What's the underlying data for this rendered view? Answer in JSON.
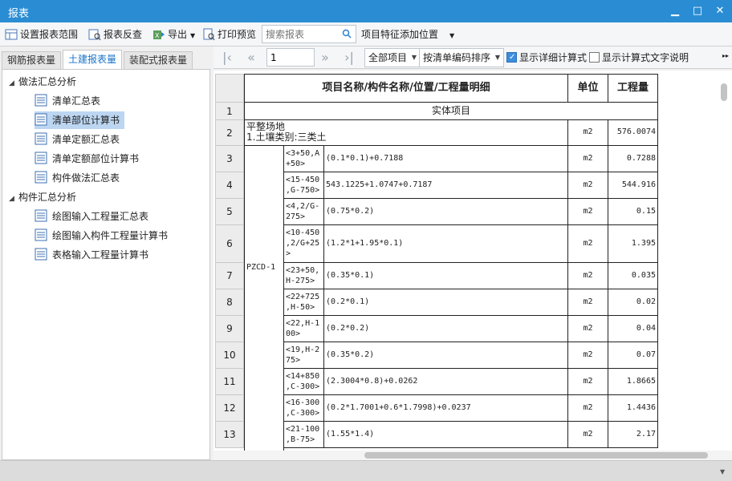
{
  "window": {
    "title": "报表",
    "min": "▁",
    "max": "□",
    "close": "✕"
  },
  "toolbar": {
    "set_range": "设置报表范围",
    "reverse": "报表反查",
    "export": "导出",
    "print_preview": "打印预览",
    "search_placeholder": "搜索报表",
    "feature_position": "项目特征添加位置"
  },
  "tabs": [
    "钢筋报表量",
    "土建报表量",
    "装配式报表量"
  ],
  "tree": {
    "groups": [
      {
        "label": "做法汇总分析",
        "items": [
          "清单汇总表",
          "清单部位计算书",
          "清单定额汇总表",
          "清单定额部位计算书",
          "构件做法汇总表"
        ]
      },
      {
        "label": "构件汇总分析",
        "items": [
          "绘图输入工程量汇总表",
          "绘图输入构件工程量计算书",
          "表格输入工程量计算书"
        ]
      }
    ]
  },
  "nav": {
    "page": "1",
    "filter": "全部项目",
    "sort": "按清单编码排序",
    "show_formula": "显示详细计算式",
    "show_formula_text": "显示计算式文字说明"
  },
  "table": {
    "headers": {
      "name": "项目名称/构件名称/位置/工程量明细",
      "unit": "单位",
      "qty": "工程量"
    },
    "section": "实体项目",
    "item": {
      "title": "平整场地",
      "desc": "1.土壤类别:三类土",
      "unit": "m2",
      "qty": "576.0074"
    },
    "component": "PZCD-1",
    "rows": [
      {
        "num": "3",
        "loc": "<3+50,A +50>",
        "formula": "(0.1*0.1)+0.7188",
        "unit": "m2",
        "qty": "0.7288"
      },
      {
        "num": "4",
        "loc": "<15-450 ,G-750>",
        "formula": "543.1225+1.0747+0.7187",
        "unit": "m2",
        "qty": "544.916"
      },
      {
        "num": "5",
        "loc": "<4,2/G- 275>",
        "formula": "(0.75*0.2)",
        "unit": "m2",
        "qty": "0.15"
      },
      {
        "num": "6",
        "loc": "<10-450 ,2/G+25 >",
        "formula": "(1.2*1+1.95*0.1)",
        "unit": "m2",
        "qty": "1.395"
      },
      {
        "num": "7",
        "loc": "<23+50, H-275>",
        "formula": "(0.35*0.1)",
        "unit": "m2",
        "qty": "0.035"
      },
      {
        "num": "8",
        "loc": "<22+725 ,H-50>",
        "formula": "(0.2*0.1)",
        "unit": "m2",
        "qty": "0.02"
      },
      {
        "num": "9",
        "loc": "<22,H-1 00>",
        "formula": "(0.2*0.2)",
        "unit": "m2",
        "qty": "0.04"
      },
      {
        "num": "10",
        "loc": "<19,H-2 75>",
        "formula": "(0.35*0.2)",
        "unit": "m2",
        "qty": "0.07"
      },
      {
        "num": "11",
        "loc": "<14+850 ,C-300>",
        "formula": "(2.3004*0.8)+0.0262",
        "unit": "m2",
        "qty": "1.8665"
      },
      {
        "num": "12",
        "loc": "<16-300 ,C-300>",
        "formula": "(0.2*1.7001+0.6*1.7998)+0.0237",
        "unit": "m2",
        "qty": "1.4436"
      },
      {
        "num": "13",
        "loc": "<21-100 ,B-75>",
        "formula": "(1.55*1.4)",
        "unit": "m2",
        "qty": "2.17"
      }
    ]
  },
  "colors": {
    "titlebar": "#2a8dd4",
    "selected": "#bcd6f2",
    "accent": "#3b8ee0"
  }
}
